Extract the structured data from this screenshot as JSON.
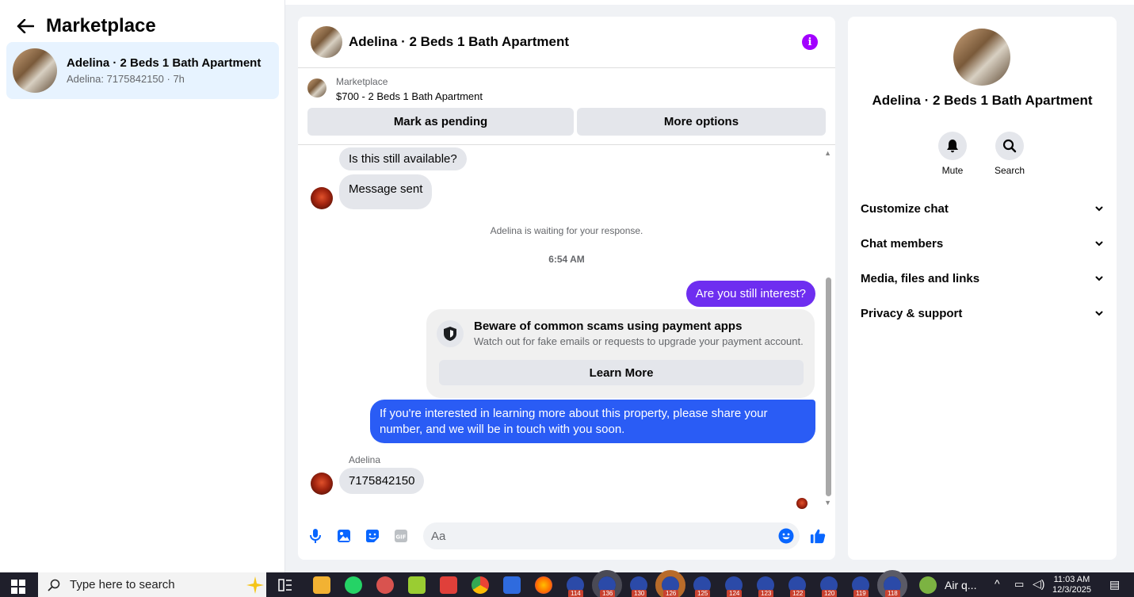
{
  "left": {
    "title": "Marketplace",
    "conversation": {
      "title": "Adelina · 2 Beds 1 Bath Apartment",
      "subtitle": "Adelina: 7175842150 · 7h"
    }
  },
  "chat": {
    "header_title": "Adelina · 2 Beds 1 Bath Apartment",
    "listing": {
      "label": "Marketplace",
      "price_title": "$700 - 2 Beds 1 Bath Apartment",
      "pending_button": "Mark as pending",
      "more_options_button": "More options"
    },
    "messages": {
      "m1": "Is this still available?",
      "m2": "Message sent",
      "waiting": "Adelina is waiting for your response.",
      "time": "6:54 AM",
      "out1": "Are you still interest?",
      "scam_title": "Beware of common scams using payment apps",
      "scam_sub": "Watch out for fake emails or requests to upgrade your payment account.",
      "learn_more": "Learn More",
      "out2": "If you're interested in learning more about this property, please share your number, and we will be in touch with you soon.",
      "sender_name": "Adelina",
      "in_phone": "7175842150"
    },
    "composer": {
      "placeholder": "Aa"
    },
    "colors": {
      "out1_bg": "#6e2ef0",
      "out2_bg": "#2a5cf5",
      "accent": "#0866ff"
    }
  },
  "right": {
    "name": "Adelina · 2 Beds 1 Bath Apartment",
    "mute_label": "Mute",
    "search_label": "Search",
    "sections": [
      "Customize chat",
      "Chat members",
      "Media, files and links",
      "Privacy & support"
    ]
  },
  "taskbar": {
    "search_placeholder": "Type here to search",
    "badges": [
      "114",
      "136",
      "130",
      "126",
      "125",
      "124",
      "123",
      "122",
      "120",
      "119",
      "118"
    ],
    "weather": "Air q...",
    "time": "11:03 AM",
    "date": "12/3/2025"
  }
}
